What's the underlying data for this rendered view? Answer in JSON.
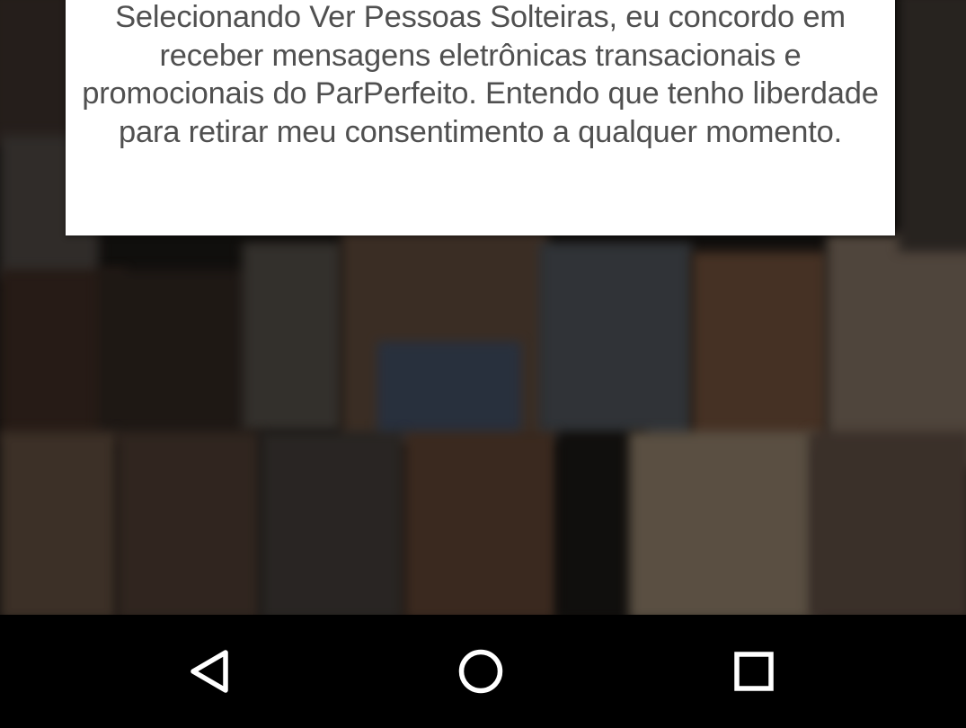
{
  "dialog": {
    "consent_text": "Selecionando Ver Pessoas Solteiras, eu concordo em receber mensagens eletrônicas transacionais e promocionais do ParPerfeito. Entendo que tenho liberdade para retirar meu consentimento a qualquer momento."
  },
  "navbar": {
    "back_icon": "back-triangle-icon",
    "home_icon": "home-circle-icon",
    "recent_icon": "recent-apps-square-icon"
  },
  "colors": {
    "dialog_background": "#ffffff",
    "dialog_text": "#505050",
    "navbar_background": "#000000",
    "nav_icon": "#ffffff"
  }
}
